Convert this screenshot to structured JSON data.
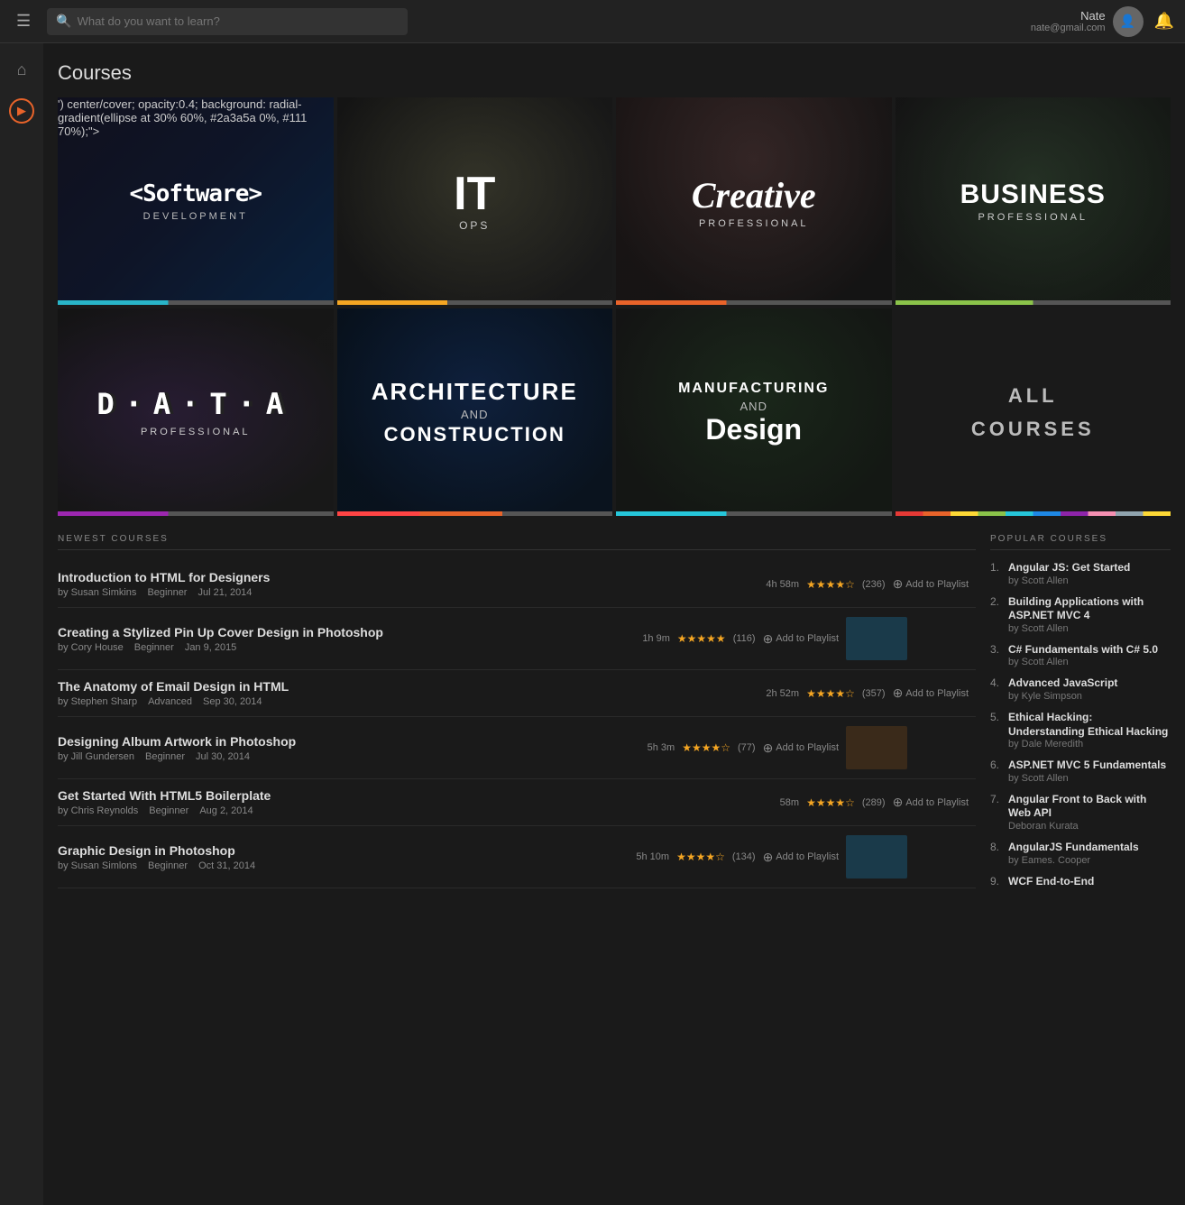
{
  "nav": {
    "hamburger_label": "☰",
    "search_placeholder": "What do you want to learn?",
    "user_name": "Nate",
    "user_email": "nate@gmail.com",
    "bell_icon": "🔔"
  },
  "sidebar": {
    "home_icon": "⌂",
    "play_icon": "▶"
  },
  "page": {
    "title": "Courses"
  },
  "course_cards": [
    {
      "id": "software",
      "title": "<Software>",
      "subtitle": "DEVELOPMENT",
      "bar_class": "bar-software",
      "bg_class": "bg-software"
    },
    {
      "id": "itops",
      "title": "IT",
      "subtitle": "OPS",
      "bar_class": "bar-itops",
      "bg_class": "bg-itops"
    },
    {
      "id": "creative",
      "title": "Creative",
      "subtitle": "PROFESSIONAL",
      "bar_class": "bar-creative",
      "bg_class": "bg-creative"
    },
    {
      "id": "business",
      "title": "BUSINESS",
      "subtitle": "PROFESSIONAL",
      "bar_class": "bar-business",
      "bg_class": "bg-business"
    },
    {
      "id": "data",
      "title": "DATA",
      "subtitle": "PROFESSIONAL",
      "bar_class": "bar-data",
      "bg_class": "bg-data"
    },
    {
      "id": "arch",
      "title": "ARCHITECTURE",
      "subtitle": "AND CONSTRUCTION",
      "bar_class": "bar-arch",
      "bg_class": "bg-arch"
    },
    {
      "id": "mfg",
      "title": "MANUFACTURING AND Design",
      "subtitle": "",
      "bar_class": "bar-mfg",
      "bg_class": "bg-mfg"
    },
    {
      "id": "all",
      "title": "ALL COURSES",
      "subtitle": "",
      "bar_class": "bar-all",
      "bg_class": "bg-all"
    }
  ],
  "newest_courses": {
    "label": "NEWEST COURSES",
    "items": [
      {
        "title": "Introduction to HTML for Designers",
        "author": "by Susan Simkins",
        "level": "Beginner",
        "date": "Jul 21, 2014",
        "duration": "4h 58m",
        "stars": 4,
        "rating_count": "(236)",
        "has_thumb": false,
        "add_label": "Add to Playlist"
      },
      {
        "title": "Creating a Stylized Pin Up Cover Design in Photoshop",
        "author": "by Cory House",
        "level": "Beginner",
        "date": "Jan 9, 2015",
        "duration": "1h 9m",
        "stars": 5,
        "rating_count": "(116)",
        "has_thumb": true,
        "add_label": "Add to Playlist"
      },
      {
        "title": "The Anatomy of Email Design in HTML",
        "author": "by Stephen Sharp",
        "level": "Advanced",
        "date": "Sep 30, 2014",
        "duration": "2h 52m",
        "stars": 4,
        "rating_count": "(357)",
        "has_thumb": false,
        "add_label": "Add to Playlist"
      },
      {
        "title": "Designing Album Artwork in Photoshop",
        "author": "by Jill Gundersen",
        "level": "Beginner",
        "date": "Jul 30, 2014",
        "duration": "5h 3m",
        "stars": 4,
        "rating_count": "(77)",
        "has_thumb": true,
        "add_label": "Add to Playlist"
      },
      {
        "title": "Get Started With HTML5 Boilerplate",
        "author": "by Chris Reynolds",
        "level": "Beginner",
        "date": "Aug 2, 2014",
        "duration": "58m",
        "stars": 4,
        "rating_count": "(289)",
        "has_thumb": false,
        "add_label": "Add to Playlist"
      },
      {
        "title": "Graphic Design in Photoshop",
        "author": "by Susan Simlons",
        "level": "Beginner",
        "date": "Oct 31, 2014",
        "duration": "5h 10m",
        "stars": 4,
        "rating_count": "(134)",
        "has_thumb": true,
        "add_label": "Add to Playlist"
      }
    ]
  },
  "popular_courses": {
    "label": "POPULAR COURSES",
    "items": [
      {
        "num": "1.",
        "title": "Angular JS: Get Started",
        "author": "by Scott Allen"
      },
      {
        "num": "2.",
        "title": "Building Applications with ASP.NET MVC 4",
        "author": "by Scott Allen"
      },
      {
        "num": "3.",
        "title": "C# Fundamentals with C# 5.0",
        "author": "by Scott Allen"
      },
      {
        "num": "4.",
        "title": "Advanced JavaScript",
        "author": "by Kyle Simpson"
      },
      {
        "num": "5.",
        "title": "Ethical Hacking: Understanding Ethical Hacking",
        "author": "by Dale Meredith"
      },
      {
        "num": "6.",
        "title": "ASP.NET MVC 5 Fundamentals",
        "author": "by Scott Allen"
      },
      {
        "num": "7.",
        "title": "Angular Front to Back with Web API",
        "author": "Deboran Kurata"
      },
      {
        "num": "8.",
        "title": "AngularJS Fundamentals",
        "author": "by Eames. Cooper"
      },
      {
        "num": "9.",
        "title": "WCF End-to-End",
        "author": ""
      }
    ]
  }
}
